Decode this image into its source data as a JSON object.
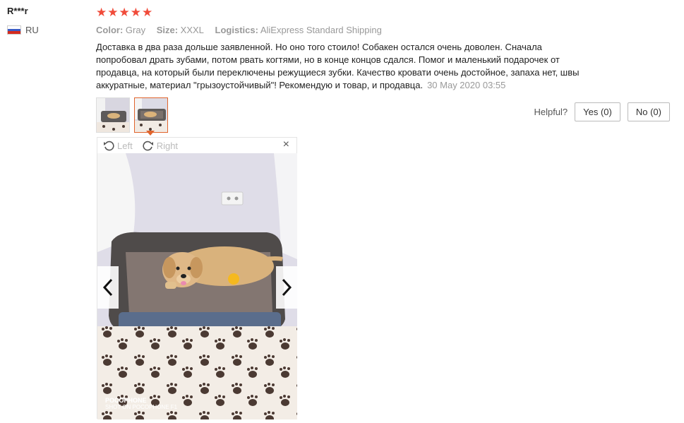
{
  "user": {
    "name": "R***r",
    "country": "RU"
  },
  "rating": {
    "stars": "★★★★★",
    "value": 5
  },
  "attributes": [
    {
      "key": "Color:",
      "value": "Gray"
    },
    {
      "key": "Size:",
      "value": "XXXL"
    },
    {
      "key": "Logistics:",
      "value": "AliExpress Standard Shipping"
    }
  ],
  "review": {
    "text": "Доставка в два раза дольше заявленной. Но оно того стоило! Собакен остался очень доволен. Сначала попробовал драть зубами, потом рвать когтями, но в конце концов сдался. Помог и маленький подарочек от продавца, на который были переключены режущиеся зубки. Качество кровати очень достойное, запаха нет, швы аккуратные, материал \"грызоустойчивый\"! Рекомендую и товар, и продавца.",
    "date": "30 May 2020 03:55"
  },
  "helpful": {
    "label": "Helpful?",
    "yes": "Yes (0)",
    "no": "No (0)"
  },
  "viewer": {
    "rotate_left": "Left",
    "rotate_right": "Right",
    "close": "×",
    "watermark_line1": "POCOPHONE",
    "watermark_line2": "SHOT ON POCOPHONE F1"
  }
}
